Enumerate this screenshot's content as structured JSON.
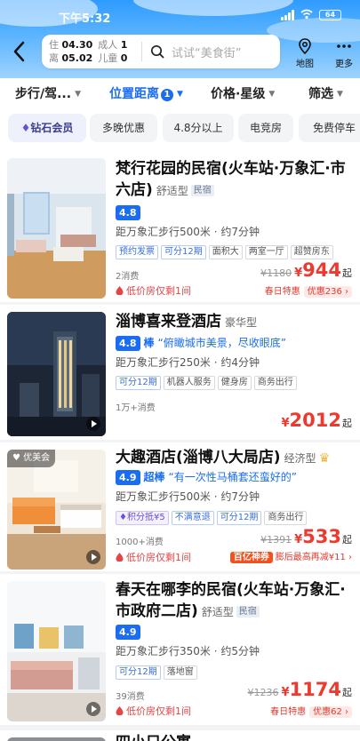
{
  "status": {
    "time": "下午5:32",
    "battery": "64"
  },
  "header": {
    "checkin_label": "住",
    "checkin_date": "04.30",
    "checkout_label": "离",
    "checkout_date": "05.02",
    "adults_label": "成人",
    "adults": "1",
    "children_label": "儿童",
    "children": "0",
    "search_placeholder": "试试“美食街”",
    "map_label": "地图",
    "more_label": "更多"
  },
  "filters": [
    {
      "label": "步行/驾..."
    },
    {
      "label": "位置距离",
      "count": "1"
    },
    {
      "label": "价格·星级"
    },
    {
      "label": "筛选"
    }
  ],
  "chips": [
    "钻石会员",
    "多晚优惠",
    "4.8分以上",
    "电竞房",
    "免费停车"
  ],
  "hotels": [
    {
      "name": "梵行花园的民宿(火车站·万象汇·市六店)",
      "type": "舒适型",
      "mini_tag": "民宿",
      "score": "4.8",
      "distance": "距万象汇步行500米 · 约7分钟",
      "tags": [
        "预约发票",
        "可分12期",
        "面积大",
        "两室一厅",
        "超赞房东"
      ],
      "consumption": "2消费",
      "low_price": "低价房仅剩1间",
      "orig_price": "¥1180",
      "price": "944",
      "yen": "¥",
      "qi": "起",
      "promo_text": "春日特惠",
      "promo_offer": "优惠236 ›"
    },
    {
      "name": "淄博喜来登酒店",
      "type": "豪华型",
      "score": "4.8",
      "score_word": "棒",
      "quote": "“俯瞰城市美景，尽收眼底”",
      "distance": "距万象汇步行250米 · 约4分钟",
      "tags": [
        "可分12期",
        "机器人服务",
        "健身房",
        "商务出行"
      ],
      "consumption": "1万+消费",
      "price": "2012",
      "yen": "¥",
      "qi": "起"
    },
    {
      "name": "大趣酒店(淄博八大局店)",
      "type": "经济型",
      "photo_badge": "优美会",
      "score": "4.9",
      "score_word": "超棒",
      "quote": "“有一次性马桶套还蛮好的”",
      "distance": "距万象汇步行500米 · 约7分钟",
      "tags": [
        "积分抵¥5",
        "不满意退",
        "可分12期",
        "商务出行"
      ],
      "consumption": "1000+消费",
      "low_price": "低价房仅剩1间",
      "orig_price": "¥1391",
      "price": "533",
      "yen": "¥",
      "qi": "起",
      "promo_tag": "百亿神券",
      "promo_text": "膨后最高再减¥11 ›"
    },
    {
      "name": "春天在哪李的民宿(火车站·万象汇·市政府二店)",
      "type": "舒适型",
      "mini_tag": "民宿",
      "score": "4.9",
      "distance": "距万象汇步行350米 · 约5分钟",
      "tags": [
        "可分12期",
        "落地窗"
      ],
      "consumption": "39消费",
      "low_price": "低价房仅剩1间",
      "orig_price": "¥1236",
      "price": "1174",
      "yen": "¥",
      "qi": "起",
      "promo_text": "春日特惠",
      "promo_offer": "优惠62 ›"
    },
    {
      "name": "四小只公寓"
    }
  ]
}
